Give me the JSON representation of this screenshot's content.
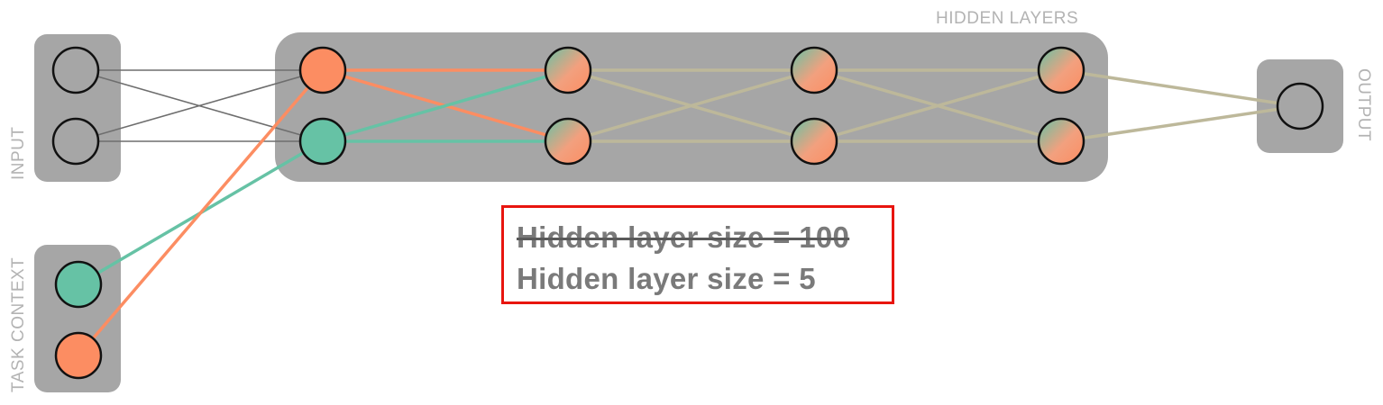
{
  "labels": {
    "input": "INPUT",
    "task_context": "TASK CONTEXT",
    "hidden_layers": "HIDDEN LAYERS",
    "output": "OUTPUT"
  },
  "note": {
    "old_text": "Hidden layer size = 100",
    "new_text": "Hidden layer size = 5"
  },
  "colors": {
    "panel": "#a6a6a6",
    "orange": "#fc8d62",
    "teal": "#66c2a5",
    "gray_edge": "#6e6e6e",
    "tan_edge": "#bdb89a",
    "label": "#b3b3b3",
    "note_border": "#e8150f"
  }
}
